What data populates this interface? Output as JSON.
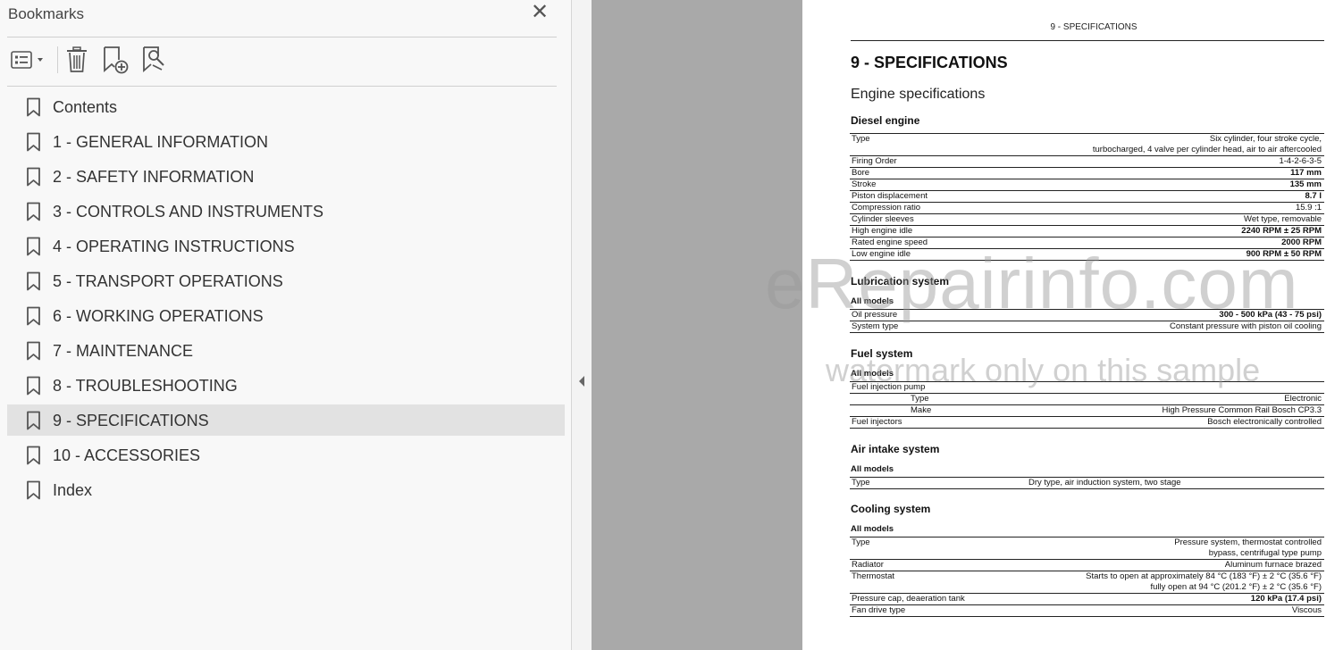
{
  "panel": {
    "title": "Bookmarks",
    "close_icon": "close-icon",
    "toolbar": {
      "options_icon": "bookmark-options-icon",
      "delete_icon": "trash-icon",
      "new_icon": "new-bookmark-icon",
      "find_icon": "find-bookmark-icon"
    },
    "selected_index": 9,
    "items": [
      {
        "label": "Contents"
      },
      {
        "label": "1 - GENERAL INFORMATION"
      },
      {
        "label": "2 - SAFETY INFORMATION"
      },
      {
        "label": "3 - CONTROLS AND INSTRUMENTS"
      },
      {
        "label": "4 - OPERATING INSTRUCTIONS"
      },
      {
        "label": "5 - TRANSPORT OPERATIONS"
      },
      {
        "label": "6 - WORKING OPERATIONS"
      },
      {
        "label": "7 - MAINTENANCE"
      },
      {
        "label": "8 - TROUBLESHOOTING"
      },
      {
        "label": "9 - SPECIFICATIONS"
      },
      {
        "label": "10 - ACCESSORIES"
      },
      {
        "label": "Index"
      }
    ]
  },
  "document": {
    "running_head": "9 - SPECIFICATIONS",
    "chapter_title": "9 - SPECIFICATIONS",
    "subtitle": "Engine specifications",
    "diesel": {
      "title": "Diesel engine",
      "rows": [
        {
          "k": "Type",
          "v": "Six cylinder, four stroke cycle,",
          "v2": "turbocharged, 4 valve per cylinder head, air to air aftercooled"
        },
        {
          "k": "Firing Order",
          "v": "1-4-2-6-3-5"
        },
        {
          "k": "Bore",
          "v": "117 mm",
          "bold": true
        },
        {
          "k": "Stroke",
          "v": "135 mm",
          "bold": true
        },
        {
          "k": "Piston displacement",
          "v": "8.7 l",
          "bold": true
        },
        {
          "k": "Compression ratio",
          "v": "15.9 :1"
        },
        {
          "k": "Cylinder sleeves",
          "v": "Wet type, removable"
        },
        {
          "k": "High engine idle",
          "v": "2240 RPM ± 25 RPM",
          "bold": true
        },
        {
          "k": "Rated engine speed",
          "v": "2000 RPM",
          "bold": true
        },
        {
          "k": "Low engine idle",
          "v": "900 RPM ± 50 RPM",
          "bold": true
        }
      ]
    },
    "lubrication": {
      "title": "Lubrication system",
      "group": "All models",
      "rows": [
        {
          "k": "Oil pressure",
          "v": "300 - 500 kPa (43 - 75 psi)",
          "bold": true
        },
        {
          "k": "System type",
          "v": "Constant pressure with piston oil cooling"
        }
      ]
    },
    "fuel": {
      "title": "Fuel system",
      "group": "All models",
      "rows": [
        {
          "k": "Fuel injection pump",
          "v": ""
        },
        {
          "k": "Type",
          "v": "Electronic",
          "indent": true
        },
        {
          "k": "Make",
          "v": "High Pressure Common Rail Bosch CP3.3",
          "indent": true
        },
        {
          "k": "Fuel injectors",
          "v": "Bosch electronically controlled"
        }
      ]
    },
    "air": {
      "title": "Air intake system",
      "group": "All models",
      "rows": [
        {
          "k": "Type",
          "v": "Dry type, air induction system, two stage",
          "center": true
        }
      ]
    },
    "cooling": {
      "title": "Cooling system",
      "group": "All models",
      "rows": [
        {
          "k": "Type",
          "v": "Pressure system, thermostat controlled",
          "v2": "bypass, centrifugal type pump"
        },
        {
          "k": "Radiator",
          "v": "Aluminum furnace brazed"
        },
        {
          "k": "Thermostat",
          "v": "Starts to open at approximately 84 °C (183 °F) ± 2 °C (35.6 °F)",
          "v2": "fully open at 94 °C (201.2 °F) ± 2 °C (35.6 °F)"
        },
        {
          "k": "Pressure cap, deaeration tank",
          "v": "120 kPa (17.4 psi)",
          "bold": true
        },
        {
          "k": "Fan drive type",
          "v": "Viscous"
        }
      ]
    }
  },
  "watermark": {
    "line1": "eRepairinfo.com",
    "line2": "watermark only on this sample"
  }
}
